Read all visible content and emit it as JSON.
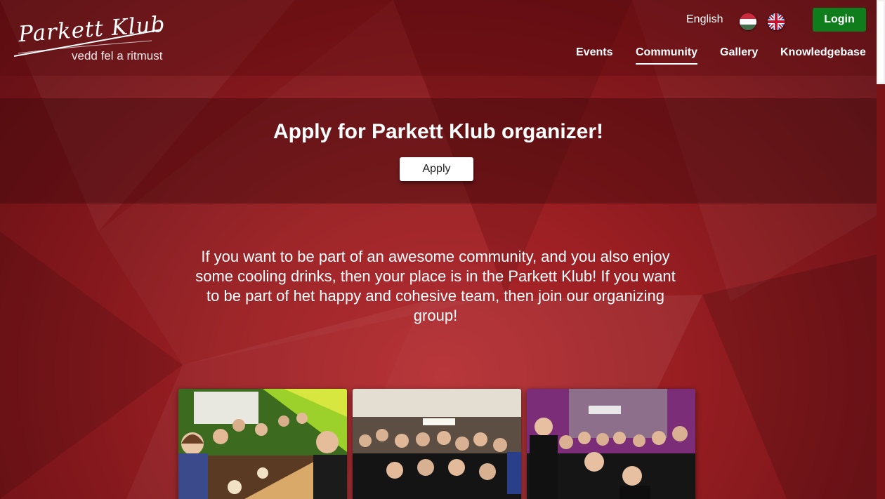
{
  "brand": {
    "name": "Parkett Klub",
    "tagline": "vedd fel a ritmust"
  },
  "header": {
    "language": "English",
    "login_label": "Login",
    "nav": [
      "Events",
      "Community",
      "Gallery",
      "Knowledgebase"
    ],
    "active_nav": "Community"
  },
  "band": {
    "title": "Apply for Parkett Klub organizer!",
    "apply_label": "Apply"
  },
  "intro": {
    "text": "If you want to be part of an awesome community, and you also enjoy some cooling drinks, then your place is in the Parkett Klub! If you want to be part of het happy and cohesive team, then join our organizing group!"
  },
  "colors": {
    "background": "#8e1c20",
    "login_button": "#0f7d1c",
    "apply_button": "#ffffff"
  },
  "icons": {
    "hungarian_flag": "flag-hu-icon",
    "english_flag": "flag-gb-icon"
  }
}
